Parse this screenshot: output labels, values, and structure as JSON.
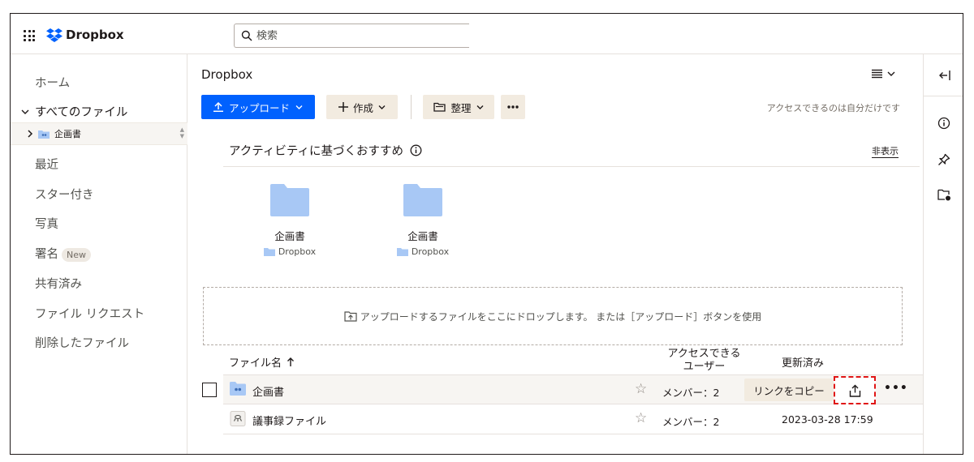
{
  "header": {
    "brand": "Dropbox",
    "search_placeholder": "検索"
  },
  "sidebar": {
    "home": "ホーム",
    "all_files": "すべてのファイル",
    "tree_item": "企画書",
    "recent": "最近",
    "starred": "スター付き",
    "photos": "写真",
    "signatures": "署名",
    "new_badge": "New",
    "shared": "共有済み",
    "file_requests": "ファイル リクエスト",
    "deleted": "削除したファイル"
  },
  "main": {
    "breadcrumb": "Dropbox",
    "upload_label": "アップロード",
    "create_label": "作成",
    "organize_label": "整理",
    "access_note": "アクセスできるのは自分だけです",
    "suggestions_title": "アクティビティに基づくおすすめ",
    "hide_label": "非表示",
    "cards": [
      {
        "name": "企画書",
        "location": "Dropbox"
      },
      {
        "name": "企画書",
        "location": "Dropbox"
      }
    ],
    "dropzone_text": "アップロードするファイルをここにドロップします。 または［アップロード］ボタンを使用",
    "columns": {
      "name": "ファイル名",
      "access_line1": "アクセスできる",
      "access_line2": "ユーザー",
      "modified": "更新済み"
    },
    "rows": [
      {
        "name": "企画書",
        "members": "メンバー：2",
        "copy_link": "リンクをコピー"
      },
      {
        "name": "議事録ファイル",
        "members": "メンバー：2",
        "modified": "2023-03-28 17:59"
      }
    ]
  },
  "colors": {
    "primary": "#0061fe",
    "soft_button": "#f2ebe0",
    "highlight": "#e01515",
    "folder": "#a8c8f5"
  }
}
